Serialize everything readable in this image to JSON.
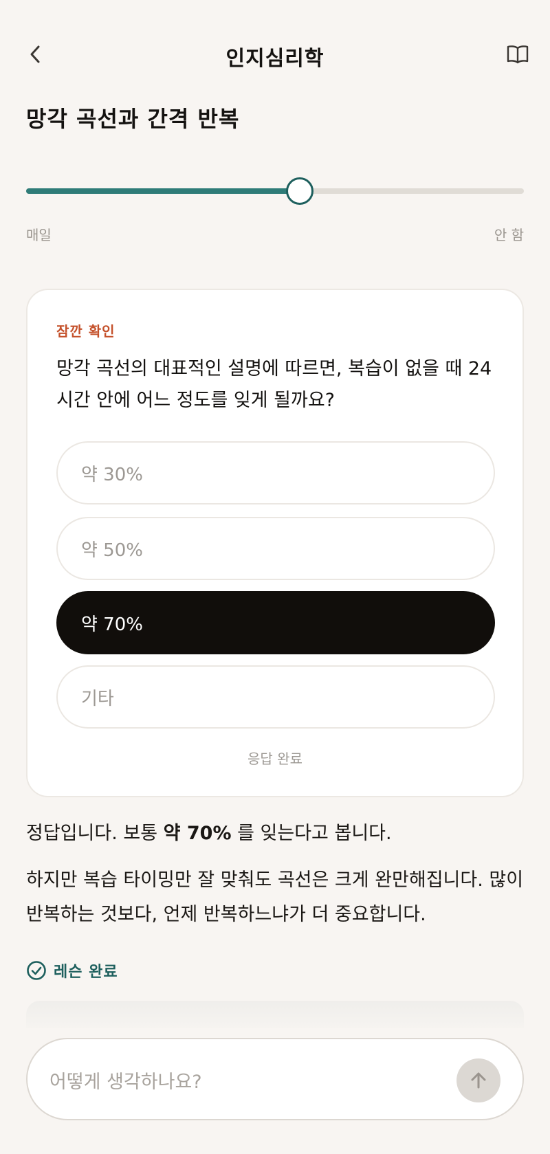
{
  "colors": {
    "background": "#f8f5f2",
    "accent_teal": "#2f7c78",
    "accent_orange": "#c4502a",
    "selected_option": "#110e0b"
  },
  "header": {
    "back_icon": "chevron-left-icon",
    "title": "인지심리학",
    "book_icon": "book-icon"
  },
  "lesson": {
    "title": "망각 곡선과 간격 반복"
  },
  "frequency_slider": {
    "value": 0.55,
    "min_label": "매일",
    "max_label": "안 함"
  },
  "quiz": {
    "kicker": "잠깐 확인",
    "question": "망각 곡선의 대표적인 설명에 따르면, 복습이 없을 때 24시간 안에 어느 정도를 잊게 될까요?",
    "options": [
      {
        "label": "약 30%",
        "selected": false
      },
      {
        "label": "약 50%",
        "selected": false
      },
      {
        "label": "약 70%",
        "selected": true
      },
      {
        "label": "기타",
        "selected": false
      }
    ],
    "status": "응답 완료"
  },
  "feedback": {
    "prefix": "정답입니다. 보통",
    "highlight": "약 70%",
    "suffix": "를 잊는다고 봅니다.",
    "explanation": "하지만 복습 타이밍만 잘 맞춰도 곡선은 크게 완만해집니다. 많이 반복하는 것보다, 언제 반복하느냐가 더 중요합니다."
  },
  "completion": {
    "icon": "check-circle-icon",
    "label": "레슨 완료"
  },
  "composer": {
    "placeholder": "어떻게 생각하나요?",
    "send_icon": "arrow-up-icon"
  }
}
